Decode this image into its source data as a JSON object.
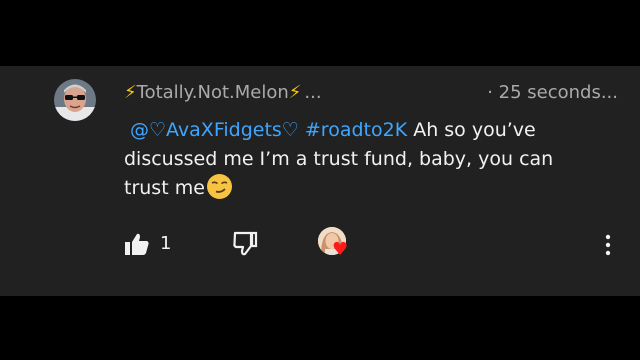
{
  "comment": {
    "author": {
      "prefix_icon": "lightning-bolt-icon",
      "name": "Totally.Not.Melon",
      "suffix_icon": "lightning-bolt-icon",
      "ellipsis": "..."
    },
    "timestamp": "· 25 seconds...",
    "mention": "@♡AvaXFidgets♡",
    "hashtag": "#roadto2K",
    "text": "Ah so you’ve discussed me I’m a trust fund, baby, you can trust me",
    "emoji": "smirking-face-emoji",
    "likes": "1",
    "creator_heart": "heart-icon"
  },
  "colors": {
    "background": "#000000",
    "card": "#212121",
    "link": "#3ea6ff",
    "meta": "#aaaaaa",
    "heart": "#ff1a1a",
    "bolt": "#f7c600"
  }
}
